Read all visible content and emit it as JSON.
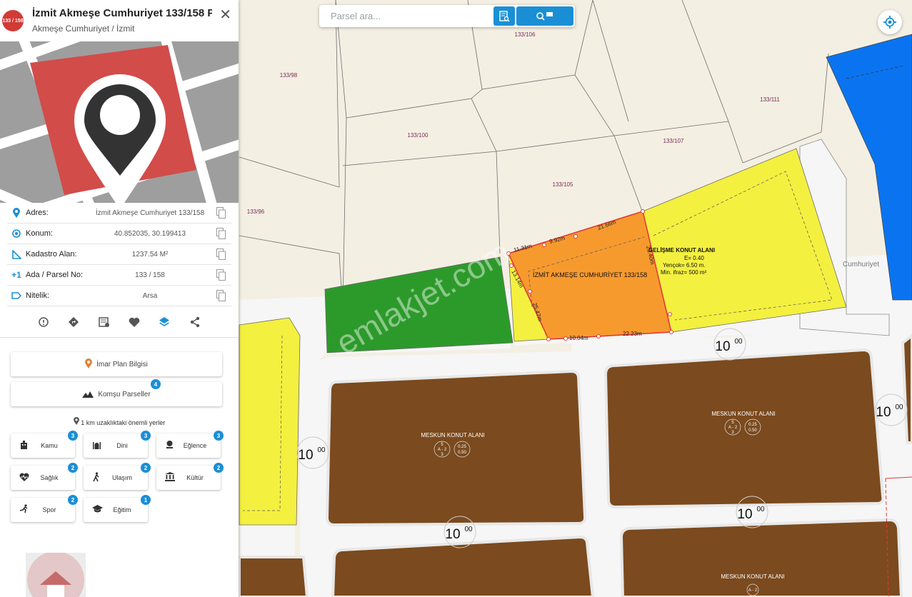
{
  "search": {
    "placeholder": "Parsel ara..."
  },
  "panel": {
    "badge": "133 / 158",
    "title": "İzmit Akmeşe Cumhuriyet 133/158 P...",
    "subtitle": "Akmeşe Cumhuriyet / İzmit",
    "info": [
      {
        "icon": "location-pin-icon",
        "label": "Adres:",
        "value": "İzmit Akmeşe Cumhuriyet 133/158"
      },
      {
        "icon": "crosshair-icon",
        "label": "Konum:",
        "value": "40.852035, 30.199413"
      },
      {
        "icon": "area-ruler-icon",
        "label": "Kadastro Alan:",
        "value": "1237.54 M²"
      },
      {
        "icon": "plus-one-icon",
        "label": "Ada / Parsel No:",
        "value": "133 / 158"
      },
      {
        "icon": "label-tag-icon",
        "label": "Nitelik:",
        "value": "Arsa"
      }
    ],
    "imar_button": "İmar Plan Bilgisi",
    "komsu_button": "Komşu Parseller",
    "komsu_count": "4",
    "nearby_title": "1 km uzaklıktaki önemli yerler",
    "categories": [
      {
        "label": "Kamu",
        "count": "3",
        "icon": "building-icon"
      },
      {
        "label": "Dini",
        "count": "3",
        "icon": "mosque-icon"
      },
      {
        "label": "Eğlence",
        "count": "3",
        "icon": "entertainment-icon"
      },
      {
        "label": "Sağlık",
        "count": "2",
        "icon": "heart-pulse-icon"
      },
      {
        "label": "Ulaşım",
        "count": "2",
        "icon": "walking-icon"
      },
      {
        "label": "Kültür",
        "count": "2",
        "icon": "museum-icon"
      },
      {
        "label": "Spor",
        "count": "2",
        "icon": "running-icon"
      },
      {
        "label": "Eğitim",
        "count": "1",
        "icon": "graduation-cap-icon"
      }
    ]
  },
  "map": {
    "parcels": [
      "133/98",
      "133/106",
      "133/111",
      "133/100",
      "133/107",
      "133/105",
      "133/96"
    ],
    "selected_label": "İZMİT AKMEŞE CUMHURİYET 133/158",
    "zone_title": "GELİŞME KONUT ALANI",
    "zone_lines": [
      "E= 0.40",
      "Yençok= 6.50 m.",
      "Min. ifraz= 500 m²"
    ],
    "meskun_label": "MESKUN KONUT ALANI",
    "road_width": "10",
    "road_width_sup": "00",
    "street_label": "Cumhuriyet",
    "dimensions": [
      "11.31m",
      "9.92m",
      "21.66m",
      "13.14m",
      "25.47m",
      "23.40m",
      "10.04m",
      "22.23m"
    ],
    "watermark": "emlakjet.com",
    "meskun_ratio_1": "0.25",
    "meskun_ratio_2": "0.50",
    "meskun_floor_top": "5",
    "meskun_floor_mid": "A - 2",
    "meskun_floor_bot": "3"
  }
}
